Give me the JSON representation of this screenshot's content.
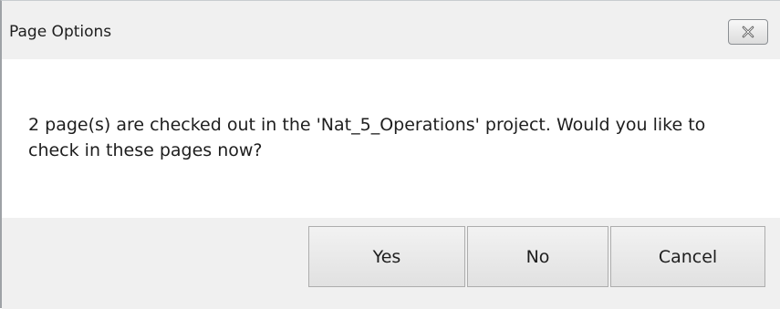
{
  "window": {
    "title": "Page Options",
    "close_icon": "close-icon"
  },
  "message": {
    "text": "2 page(s) are checked out in the 'Nat_5_Operations' project. Would you like to check in these pages now?"
  },
  "buttons": {
    "yes": "Yes",
    "no": "No",
    "cancel": "Cancel"
  }
}
